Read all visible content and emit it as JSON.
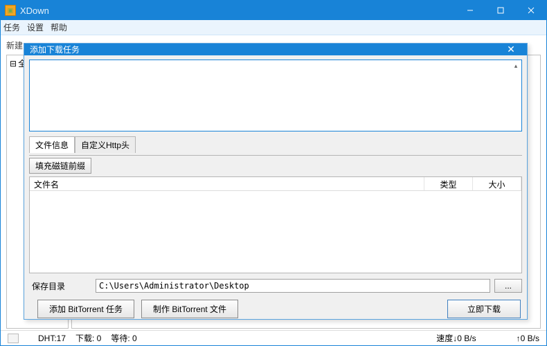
{
  "window": {
    "title": "XDown"
  },
  "menu": {
    "task": "任务",
    "settings": "设置",
    "help": "帮助"
  },
  "toolbar": {
    "new_label": "新建"
  },
  "sidebar": {
    "all_label": "全"
  },
  "modal": {
    "title": "添加下载任务",
    "tabs": {
      "file_info": "文件信息",
      "custom_http": "自定义Http头"
    },
    "fill_magnet_prefix": "填充磁链前缀",
    "columns": {
      "name": "文件名",
      "type": "类型",
      "size": "大小"
    },
    "save_dir_label": "保存目录",
    "save_dir_value": "C:\\Users\\Administrator\\Desktop",
    "browse_label": "...",
    "add_bt_task": "添加 BitTorrent 任务",
    "make_bt_file": "制作 BitTorrent 文件",
    "download_now": "立即下载"
  },
  "status": {
    "dht": "DHT:17",
    "downloading": "下载: 0",
    "waiting": "等待: 0",
    "speed": "速度↓0 B/s",
    "upspeed": "↑0 B/s"
  }
}
